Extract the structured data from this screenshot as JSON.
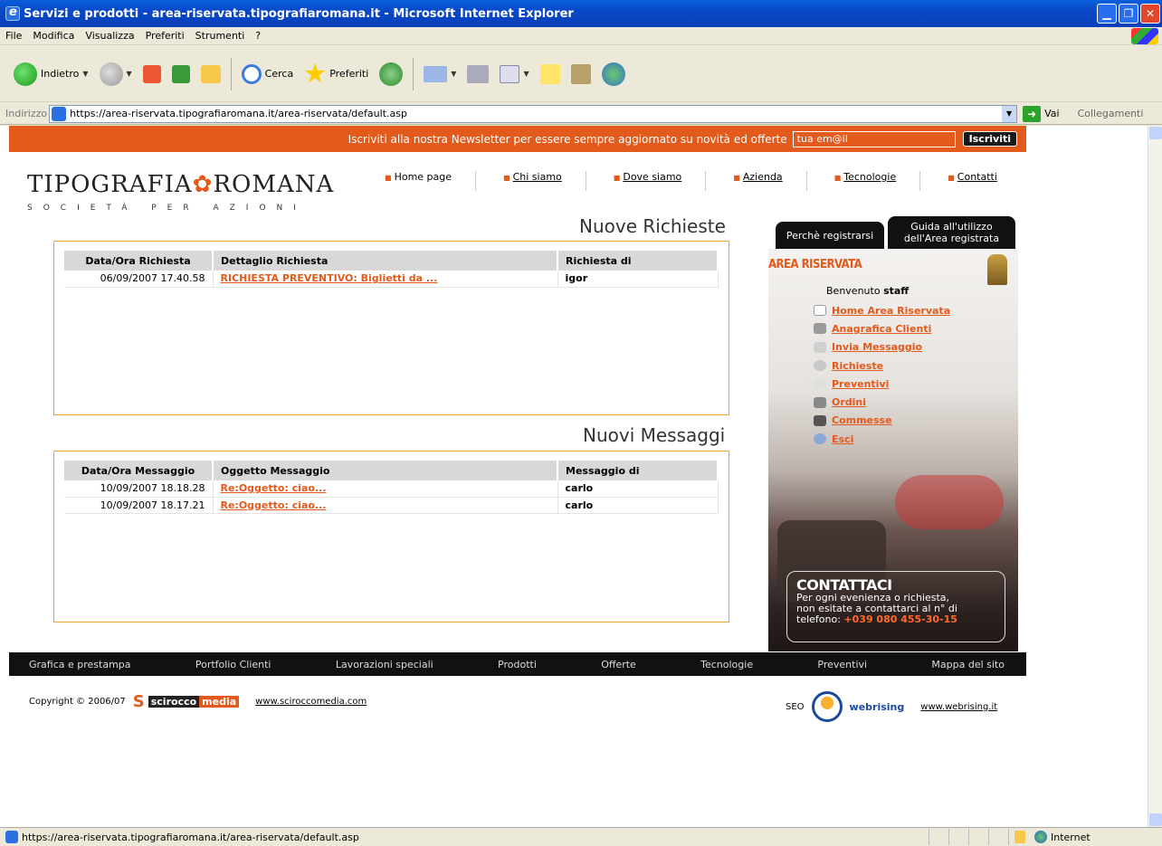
{
  "window": {
    "title": "Servizi e prodotti - area-riservata.tipografiaromana.it - Microsoft Internet Explorer",
    "controls": [
      "minimize",
      "maximize",
      "close"
    ]
  },
  "menubar": [
    "File",
    "Modifica",
    "Visualizza",
    "Preferiti",
    "Strumenti",
    "?"
  ],
  "toolbar": {
    "back": "Indietro",
    "search": "Cerca",
    "favorites": "Preferiti"
  },
  "address": {
    "label": "Indirizzo",
    "url": "https://area-riservata.tipografiaromana.it/area-riservata/default.asp",
    "go": "Vai",
    "links": "Collegamenti"
  },
  "newsletter": {
    "text": "Iscriviti alla nostra Newsletter per essere sempre aggiornato su novità ed offerte",
    "input_value": "tua em@il",
    "button": "Iscriviti"
  },
  "logo": {
    "word1": "TIPOGRAFIA",
    "word2": "ROMANA",
    "sub": "SOCIETÀ PER AZIONI"
  },
  "topnav": [
    "Home page",
    "Chi siamo",
    "Dove siamo",
    "Azienda",
    "Tecnologie",
    "Contatti"
  ],
  "richieste": {
    "title": "Nuove Richieste",
    "headers": [
      "Data/Ora Richiesta",
      "Dettaglio Richiesta",
      "Richiesta di"
    ],
    "rows": [
      {
        "date": "06/09/2007 17.40.58",
        "detail": "RICHIESTA PREVENTIVO: Biglietti da ...",
        "who": "igor"
      }
    ]
  },
  "messaggi": {
    "title": "Nuovi Messaggi",
    "headers": [
      "Data/Ora Messaggio",
      "Oggetto Messaggio",
      "Messaggio di"
    ],
    "rows": [
      {
        "date": "10/09/2007 18.18.28",
        "subject": "Re:Oggetto: ciao...",
        "who": "carlo"
      },
      {
        "date": "10/09/2007 18.17.21",
        "subject": "Re:Oggetto: ciao...",
        "who": "carlo"
      }
    ]
  },
  "tabs": {
    "tab1": "Perchè registrarsi",
    "tab2_line1": "Guida all'utilizzo",
    "tab2_line2": "dell'Area registrata"
  },
  "area": {
    "title": "AREA RISERVATA",
    "welcome": "Benvenuto",
    "user": "staff",
    "menu": [
      "Home Area Riservata",
      "Anagrafica Clienti",
      "Invia Messaggio",
      "Richieste",
      "Preventivi",
      "Ordini",
      "Commesse",
      "Esci"
    ]
  },
  "contact": {
    "title": "CONTATTACI",
    "line1": "Per ogni evenienza o richiesta,",
    "line2": "non esitate a contattarci al n° di",
    "line3_prefix": "telefono:",
    "phone": "+039 080 455-30-15"
  },
  "footnav": [
    "Grafica e prestampa",
    "Portfolio Clienti",
    "Lavorazioni speciali",
    "Prodotti",
    "Offerte",
    "Tecnologie",
    "Preventivi",
    "Mappa del sito"
  ],
  "footer": {
    "copyright": "Copyright © 2006/07",
    "brand1": "scirocco",
    "brand2": "media",
    "link1": "www.sciroccomedia.com",
    "seo": "SEO",
    "brand3": "webrising",
    "link2": "www.webrising.it"
  },
  "status": {
    "url": "https://area-riservata.tipografiaromana.it/area-riservata/default.asp",
    "zone": "Internet"
  }
}
